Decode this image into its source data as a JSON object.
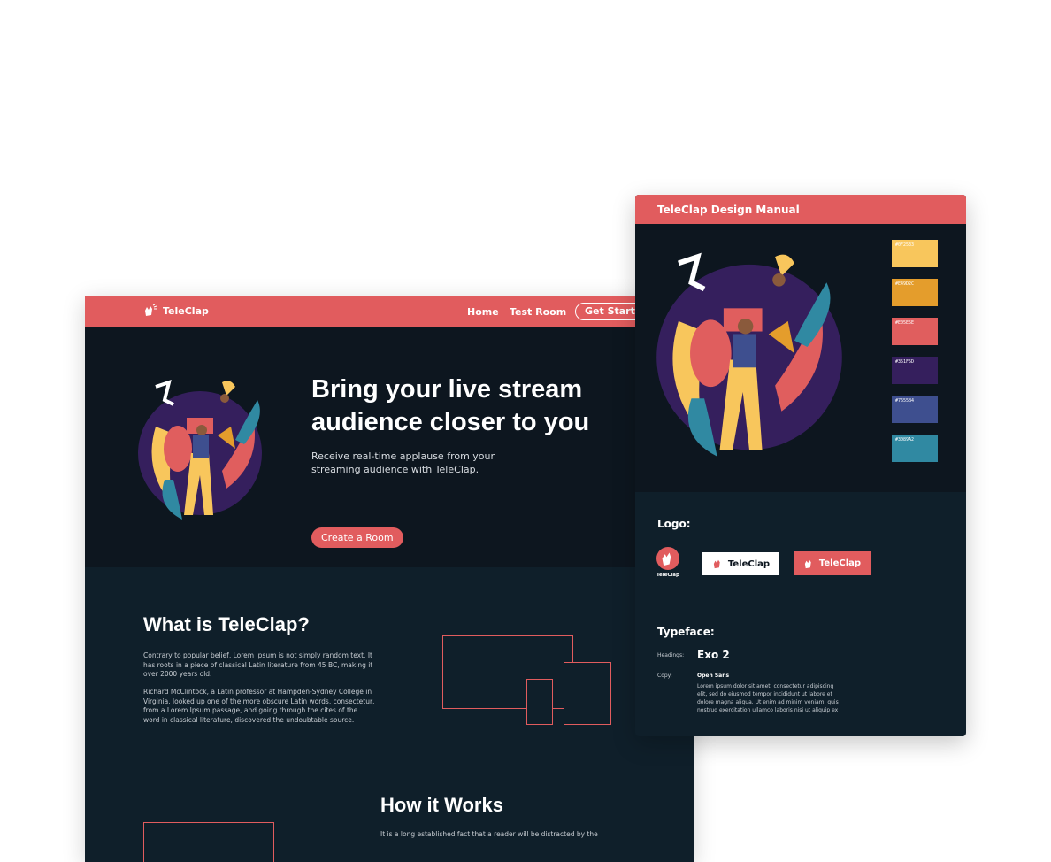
{
  "website": {
    "brand": "TeleClap",
    "nav": {
      "home": "Home",
      "test_room": "Test Room",
      "get_started": "Get Started"
    },
    "hero": {
      "title_line1": "Bring your live stream",
      "title_line2": "audience closer to you",
      "subtitle_line1": "Receive real-time applause from your",
      "subtitle_line2": "streaming audience with TeleClap.",
      "cta": "Create a Room"
    },
    "about": {
      "title": "What is TeleClap?",
      "p1": "Contrary to popular belief, Lorem Ipsum is not simply random text. It has roots in a piece of classical Latin literature from 45 BC, making it over 2000 years old.",
      "p2": "Richard McClintock, a Latin professor at Hampden-Sydney College in Virginia, looked up one of the more obscure Latin words, consectetur, from a Lorem Ipsum passage, and going through the cites of the word in classical literature, discovered the undoubtable source."
    },
    "how": {
      "title": "How it Works",
      "p1": "It is a long established fact that a reader will be distracted by the"
    }
  },
  "manual": {
    "title": "TeleClap Design Manual",
    "colors": [
      {
        "hex_label": "#0F2533",
        "color": "#f8c65c"
      },
      {
        "hex_label": "#E49D2C",
        "color": "#e49d2c"
      },
      {
        "hex_label": "#E05E5E",
        "color": "#e05e5e"
      },
      {
        "hex_label": "#351F5D",
        "color": "#351f5d"
      },
      {
        "hex_label": "#7655B4",
        "color": "#3e4f8f"
      },
      {
        "hex_label": "#3089A2",
        "color": "#3089a2"
      }
    ],
    "logo_label": "Logo:",
    "logo_name": "TeleClap",
    "typeface_label": "Typeface:",
    "headings_label": "Headings:",
    "headings_font": "Exo 2",
    "copy_label": "Copy:",
    "copy_font": "Open Sans",
    "copy_sample": "Lorem ipsum dolor sit amet, consectetur adipiscing elit, sed do eiusmod tempor incididunt ut labore et dolore magna aliqua. Ut enim ad minim veniam, quis nostrud exercitation ullamco laboris nisi ut aliquip ex"
  },
  "icons": {
    "brand_logo": "clapping-hands-icon",
    "illustration": "jazz-band-illustration"
  },
  "colors": {
    "accent": "#e15c5e",
    "dark_bg": "#0d161f",
    "section_bg": "#0f1f2a"
  }
}
